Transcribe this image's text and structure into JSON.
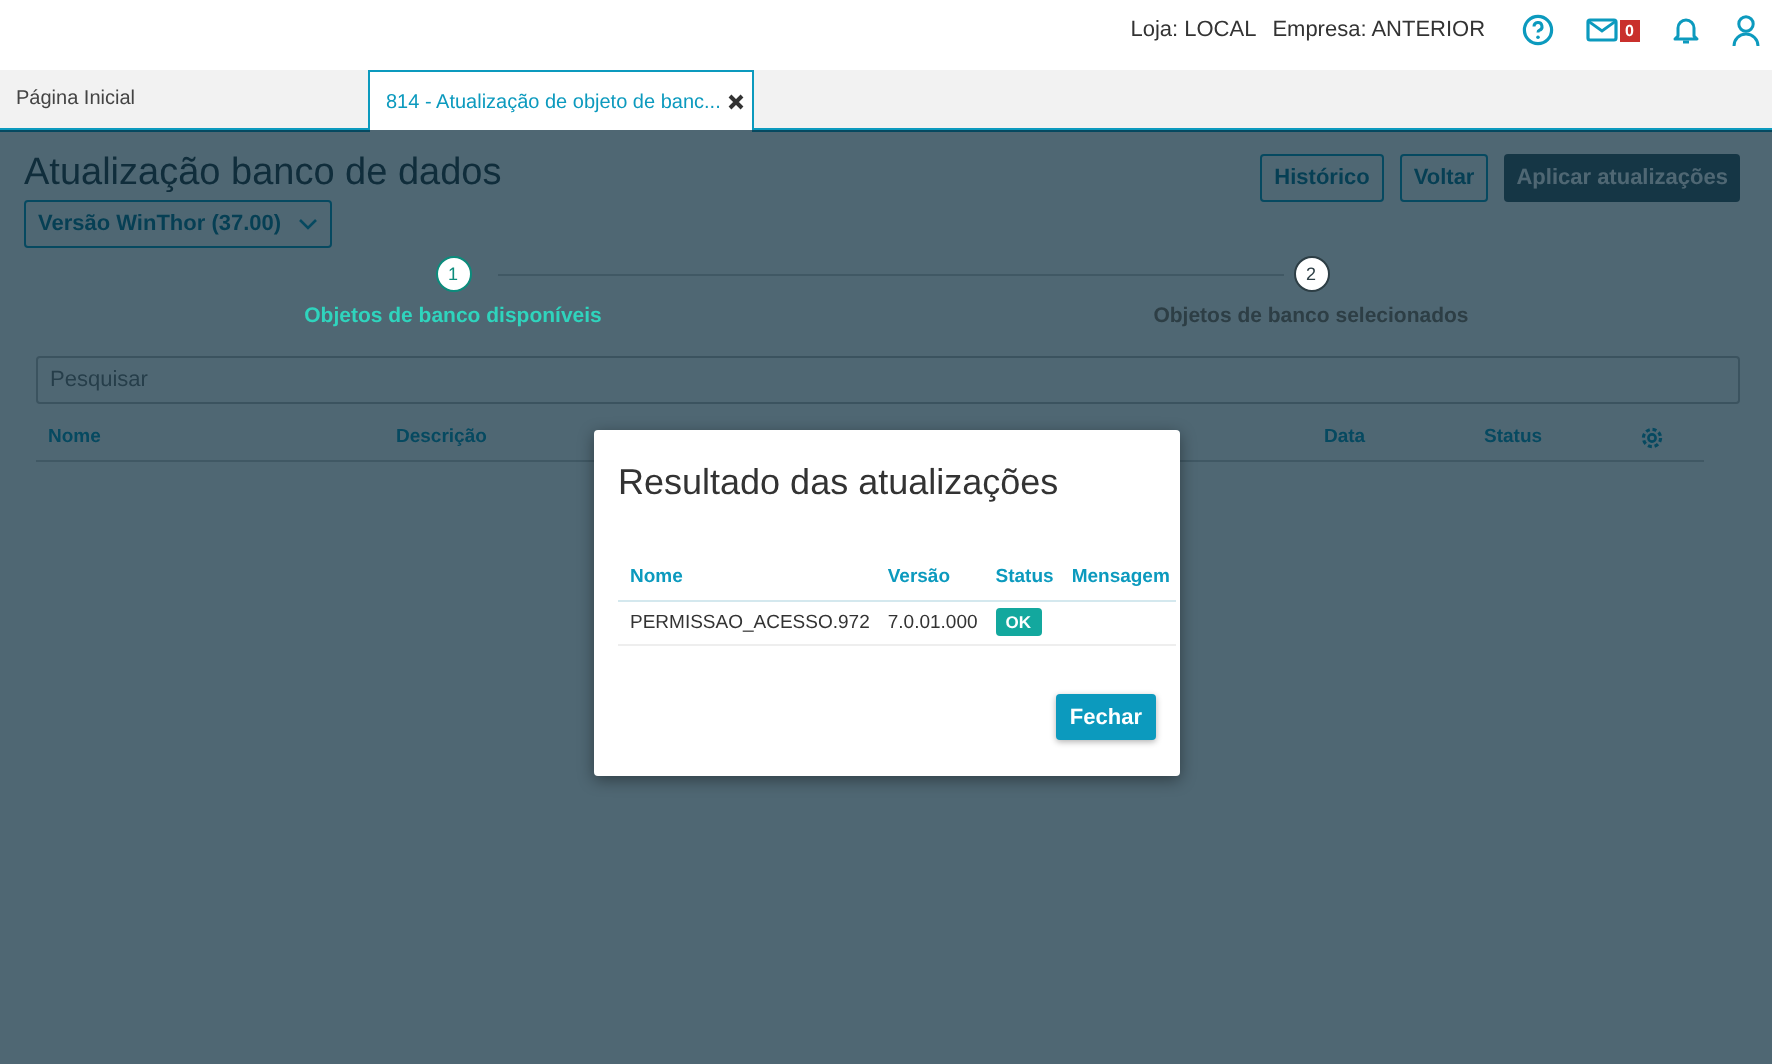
{
  "top_bar": {
    "store": "Loja: LOCAL",
    "company": "Empresa: ANTERIOR",
    "mail_count": "0"
  },
  "tabs": [
    {
      "label": "Página Inicial",
      "selected": false,
      "closable": false
    },
    {
      "label": "814 - Atualização de objeto de banc...",
      "selected": true,
      "closable": true
    }
  ],
  "page": {
    "title": "Atualização banco de dados",
    "version_dropdown": "Versão WinThor (37.00)",
    "buttons": [
      {
        "label": "Histórico",
        "disabled": false,
        "kind": "outline"
      },
      {
        "label": "Voltar",
        "disabled": false,
        "kind": "outline"
      },
      {
        "label": "Aplicar atualizações",
        "disabled": true,
        "kind": "primary"
      }
    ],
    "steps": [
      {
        "number": "1",
        "label": "Objetos de banco disponíveis",
        "selected": true
      },
      {
        "number": "2",
        "label": "Objetos de banco selecionados",
        "selected": false
      }
    ],
    "search": {
      "placeholder": "Pesquisar"
    },
    "table": {
      "columns": [
        "Nome",
        "Descrição",
        "Data",
        "Status"
      ]
    }
  },
  "dialog": {
    "title": "Resultado das atualizações",
    "columns": [
      "Nome",
      "Versão",
      "Status",
      "Mensagem"
    ],
    "rows": [
      {
        "name": "PERMISSAO_ACESSO.972",
        "version": "7.0.01.000",
        "status": "OK"
      }
    ],
    "button": "Fechar"
  }
}
